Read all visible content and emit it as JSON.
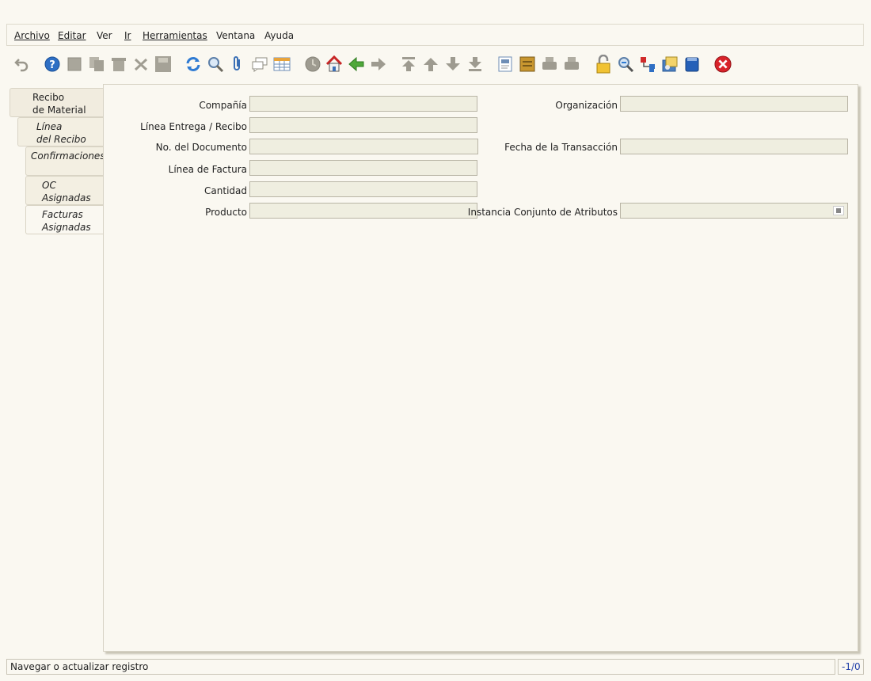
{
  "menu": {
    "archivo": "Archivo",
    "editar": "Editar",
    "ver": "Ver",
    "ir": "Ir",
    "herramientas": "Herramientas",
    "ventana": "Ventana",
    "ayuda": "Ayuda"
  },
  "toolbar_icons": [
    "undo-icon",
    "help-icon",
    "new-record-icon",
    "copy-record-icon",
    "delete-icon",
    "delete-selection-icon",
    "save-icon",
    "refresh-icon",
    "find-icon",
    "attachment-icon",
    "chat-icon",
    "grid-toggle-icon",
    "history-icon",
    "home-icon",
    "back-icon",
    "forward-icon",
    "first-record-icon",
    "previous-record-icon",
    "next-record-icon",
    "last-record-icon",
    "report-icon",
    "archive-icon",
    "print-preview-icon",
    "print-icon",
    "lock-icon",
    "zoom-across-icon",
    "workflow-icon",
    "requests-icon",
    "product-info-icon",
    "exit-icon"
  ],
  "tabs": [
    {
      "line1": "Recibo",
      "line2": "de Material"
    },
    {
      "line1": "Línea",
      "line2": "del Recibo"
    },
    {
      "line1": "Confirmaciones",
      "line2": ""
    },
    {
      "line1": "OC",
      "line2": "Asignadas"
    },
    {
      "line1": "Facturas",
      "line2": "Asignadas"
    }
  ],
  "form": {
    "compania": {
      "label": "Compañía",
      "value": ""
    },
    "organizacion": {
      "label": "Organización",
      "value": ""
    },
    "linea_entrega": {
      "label": "Línea Entrega / Recibo",
      "value": ""
    },
    "no_documento": {
      "label": "No. del Documento",
      "value": ""
    },
    "fecha_transaccion": {
      "label": "Fecha de la Transacción",
      "value": ""
    },
    "linea_factura": {
      "label": "Línea de Factura",
      "value": ""
    },
    "cantidad": {
      "label": "Cantidad",
      "value": ""
    },
    "producto": {
      "label": "Producto",
      "value": ""
    },
    "instancia": {
      "label": "Instancia Conjunto de Atributos",
      "value": ""
    }
  },
  "status": {
    "message": "Navegar o actualizar registro",
    "record_count": "-1/0"
  },
  "colors": {
    "background": "#faf8f1",
    "field_background": "#efeee0",
    "record_count_text": "#1f3ea8",
    "exit_red": "#d8232a"
  }
}
